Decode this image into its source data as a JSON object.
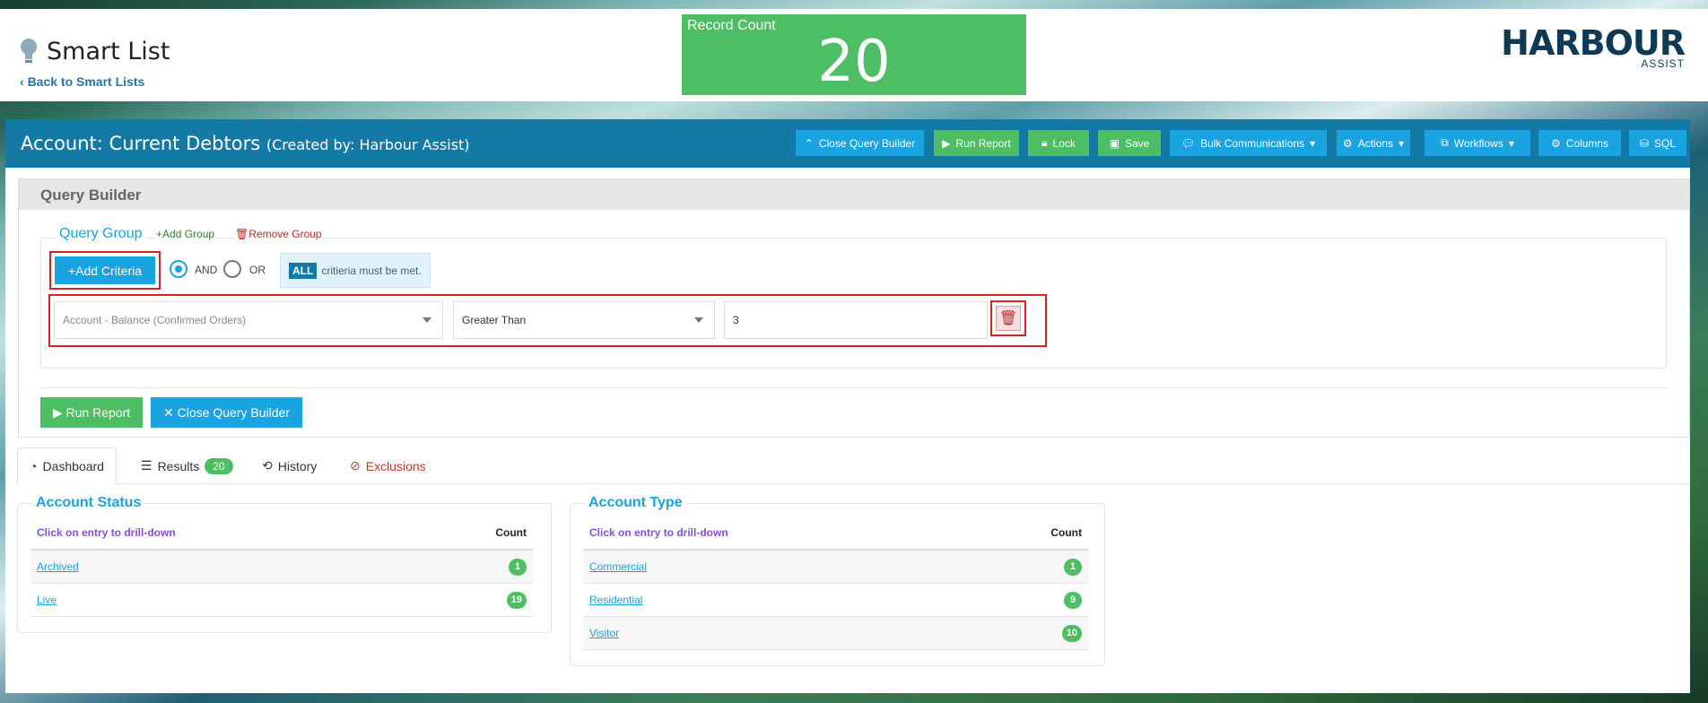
{
  "header": {
    "title": "Smart List",
    "back_link": "Back to Smart Lists",
    "record_count_label": "Record Count",
    "record_count_value": "20",
    "logo_main": "HARBOUR",
    "logo_sub": "ASSIST"
  },
  "topbar": {
    "title": "Account: Current Debtors",
    "subtitle": "(Created by: Harbour Assist)",
    "buttons": {
      "close_query_builder": "Close Query Builder",
      "run_report": "Run Report",
      "lock": "Lock",
      "save": "Save",
      "bulk_communications": "Bulk Communications",
      "actions": "Actions",
      "workflows": "Workflows",
      "columns": "Columns",
      "sql": "SQL"
    }
  },
  "query_builder": {
    "title": "Query Builder",
    "group_title": "Query Group",
    "add_group": "Add Group",
    "remove_group": "Remove Group",
    "add_criteria": "Add Criteria",
    "and_label": "AND",
    "or_label": "OR",
    "hint_badge": "ALL",
    "hint_text": "critieria must be met.",
    "criteria": {
      "field": "Account - Balance (Confirmed Orders)",
      "operator": "Greater Than",
      "value": "3"
    },
    "run_report": "Run Report",
    "close_query_builder": "Close Query Builder"
  },
  "tabs": {
    "dashboard": "Dashboard",
    "results": "Results",
    "results_count": "20",
    "history": "History",
    "exclusions": "Exclusions"
  },
  "account_status": {
    "title": "Account Status",
    "col1": "Click on entry to drill-down",
    "col2": "Count",
    "rows": [
      {
        "label": "Archived",
        "count": "1"
      },
      {
        "label": "Live",
        "count": "19"
      }
    ]
  },
  "account_type": {
    "title": "Account Type",
    "col1": "Click on entry to drill-down",
    "col2": "Count",
    "rows": [
      {
        "label": "Commercial",
        "count": "1"
      },
      {
        "label": "Residential",
        "count": "9"
      },
      {
        "label": "Visitor",
        "count": "10"
      }
    ]
  },
  "colors": {
    "primary": "#1aa3e1",
    "success": "#4dbe63",
    "topbar": "#137aa6",
    "highlight": "#d62222"
  }
}
